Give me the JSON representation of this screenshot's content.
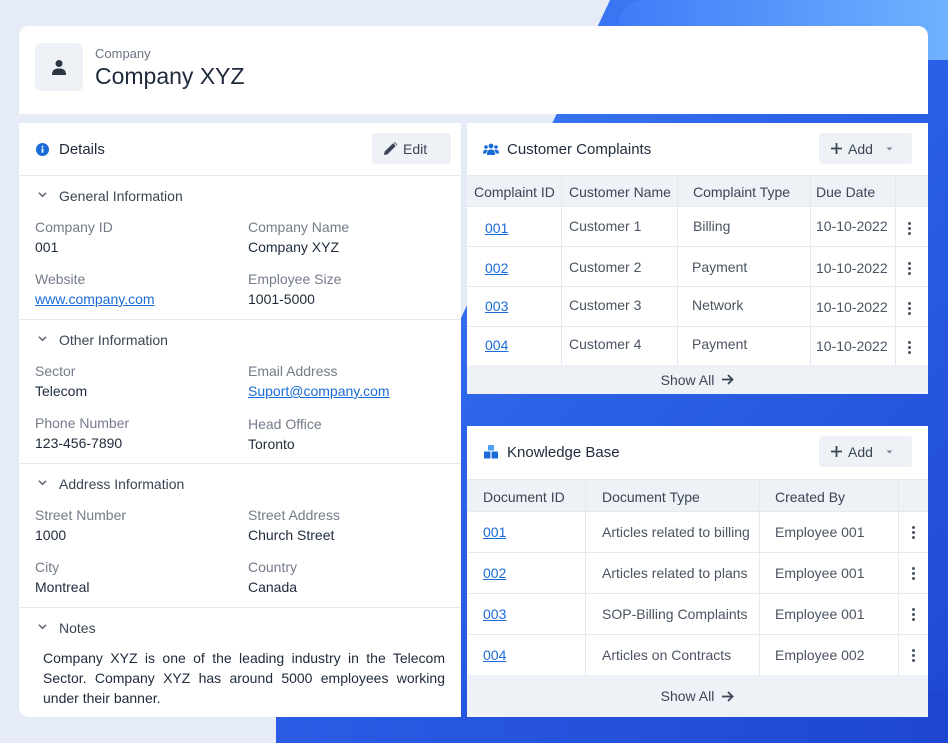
{
  "header": {
    "subtitle": "Company",
    "title": "Company XYZ"
  },
  "details": {
    "title": "Details",
    "edit_label": "Edit",
    "sections": {
      "general": {
        "title": "General Information",
        "company_id_label": "Company ID",
        "company_id": "001",
        "company_name_label": "Company Name",
        "company_name": "Company XYZ",
        "website_label": "Website",
        "website": "www.company.com",
        "employee_size_label": "Employee Size",
        "employee_size": "1001-5000"
      },
      "other": {
        "title": "Other Information",
        "sector_label": "Sector",
        "sector": "Telecom",
        "email_label": "Email Address",
        "email": "Suport@company.com",
        "phone_label": "Phone Number",
        "phone": "123-456-7890",
        "head_office_label": "Head Office",
        "head_office": "Toronto"
      },
      "address": {
        "title": "Address Information",
        "street_number_label": "Street Number",
        "street_number": "1000",
        "street_address_label": "Street Address",
        "street_address": "Church Street",
        "city_label": "City",
        "city": "Montreal",
        "country_label": "Country",
        "country": "Canada"
      },
      "notes": {
        "title": "Notes",
        "text": "Company XYZ is one of the leading industry in the Telecom Sector. Company XYZ has around 5000 employees working under their banner."
      }
    }
  },
  "complaints": {
    "title": "Customer Complaints",
    "add_label": "Add",
    "columns": [
      "Complaint ID",
      "Customer Name",
      "Complaint Type",
      "Due Date"
    ],
    "rows": [
      [
        "001",
        "Customer 1",
        "Billing",
        "10-10-2022"
      ],
      [
        "002",
        "Customer 2",
        "Payment",
        "10-10-2022"
      ],
      [
        "003",
        "Customer 3",
        "Network",
        "10-10-2022"
      ],
      [
        "004",
        "Customer 4",
        "Payment",
        "10-10-2022"
      ]
    ],
    "show_all": "Show All"
  },
  "knowledge_base": {
    "title": "Knowledge Base",
    "add_label": "Add",
    "columns": [
      "Document ID",
      "Document Type",
      "Created By"
    ],
    "rows": [
      [
        "001",
        "Articles related to billing",
        "Employee 001"
      ],
      [
        "002",
        "Articles related to plans",
        "Employee 001"
      ],
      [
        "003",
        "SOP-Billing Complaints",
        "Employee 001"
      ],
      [
        "004",
        "Articles on Contracts",
        "Employee 002"
      ]
    ],
    "show_all": "Show All"
  },
  "colors": {
    "accent": "#1a6bd8",
    "background": "#e6ebf8",
    "blob": "#2c63e8"
  },
  "icons": {
    "avatar": "user-icon",
    "details": "info-icon",
    "edit": "pencil-icon",
    "complaints": "users-icon",
    "knowledge": "cubes-icon",
    "add": "plus-icon",
    "caret": "caret-down-icon",
    "row_menu": "kebab-icon",
    "show_all": "arrow-right-icon"
  }
}
